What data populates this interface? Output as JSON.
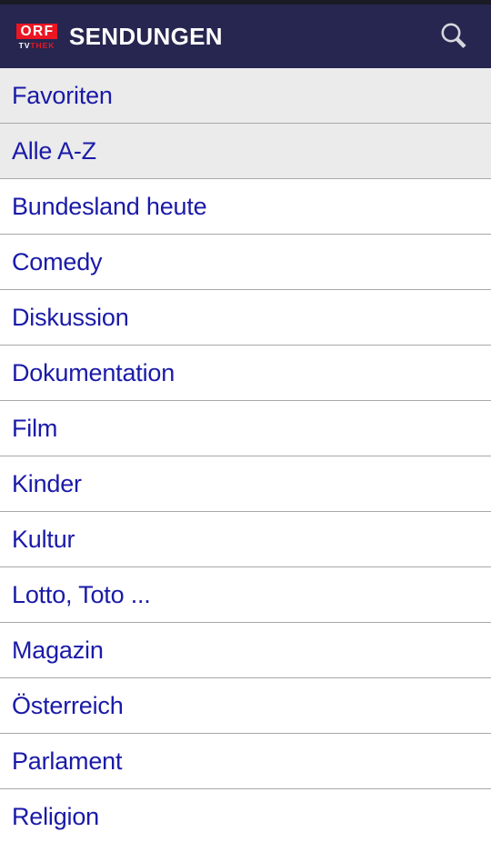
{
  "header": {
    "title": "SENDUNGEN",
    "logo": {
      "primary": "ORF",
      "secondary_light": "TV",
      "secondary_accent": "THEK"
    },
    "search_icon": "search-icon",
    "background_color": "#262650",
    "accent_color": "#eb1622",
    "title_color": "#ffffff"
  },
  "menu": {
    "link_color": "#1a1aa8",
    "divider_color": "#a8a8a8",
    "shaded_row_color": "#ebebeb",
    "items": [
      {
        "label": "Favoriten",
        "shaded": true
      },
      {
        "label": "Alle A-Z",
        "shaded": true
      },
      {
        "label": "Bundesland heute",
        "shaded": false
      },
      {
        "label": "Comedy",
        "shaded": false
      },
      {
        "label": "Diskussion",
        "shaded": false
      },
      {
        "label": "Dokumentation",
        "shaded": false
      },
      {
        "label": "Film",
        "shaded": false
      },
      {
        "label": "Kinder",
        "shaded": false
      },
      {
        "label": "Kultur",
        "shaded": false
      },
      {
        "label": "Lotto, Toto ...",
        "shaded": false
      },
      {
        "label": "Magazin",
        "shaded": false
      },
      {
        "label": "Österreich",
        "shaded": false
      },
      {
        "label": "Parlament",
        "shaded": false
      },
      {
        "label": "Religion",
        "shaded": false
      }
    ]
  }
}
